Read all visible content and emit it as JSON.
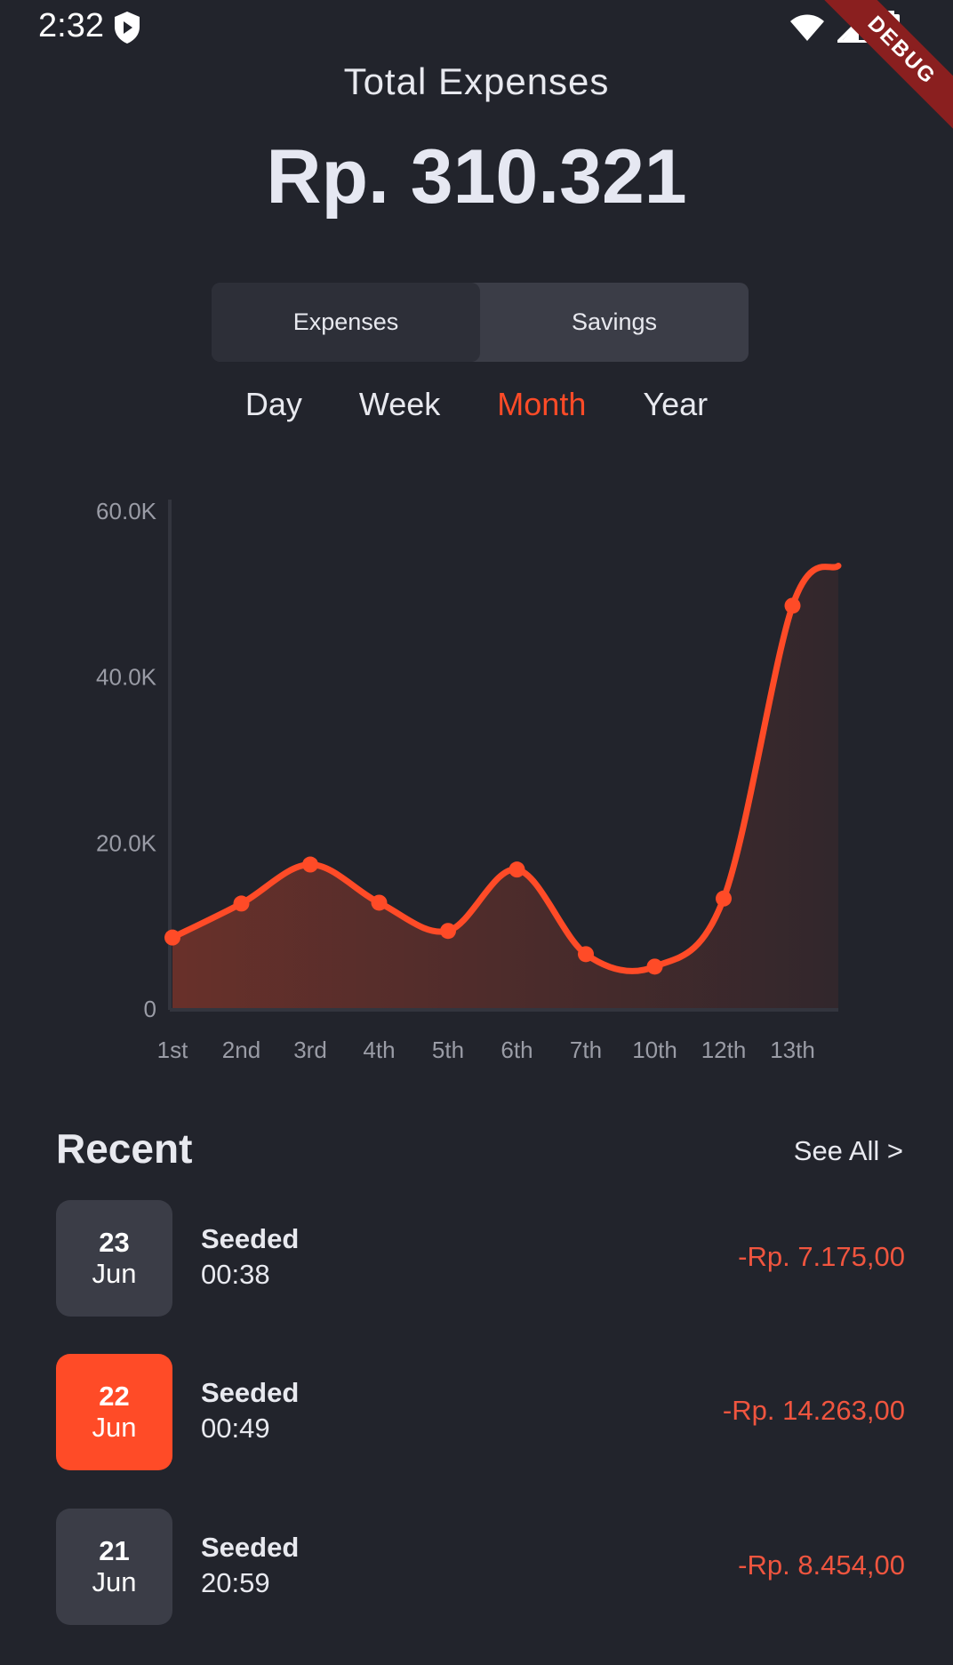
{
  "status_bar": {
    "time": "2:32",
    "debug_label": "DEBUG"
  },
  "header": {
    "title": "Total Expenses",
    "total": "Rp. 310.321"
  },
  "segmented": {
    "options": [
      "Expenses",
      "Savings"
    ],
    "selected": "Expenses"
  },
  "period_tabs": {
    "options": [
      "Day",
      "Week",
      "Month",
      "Year"
    ],
    "selected": "Month"
  },
  "colors": {
    "accent": "#ff4b27",
    "background": "#22242c",
    "card": "#3b3d47",
    "negative_amount": "#f0553f"
  },
  "chart_data": {
    "type": "area",
    "categories": [
      "1st",
      "2nd",
      "3rd",
      "4th",
      "5th",
      "6th",
      "7th",
      "10th",
      "12th",
      "13th"
    ],
    "values": [
      8500,
      12600,
      17300,
      12700,
      9300,
      16700,
      6500,
      5000,
      13200,
      48500
    ],
    "y_ticks": [
      "0",
      "20.0K",
      "40.0K",
      "60.0K"
    ],
    "ylim": [
      0,
      60000
    ],
    "smooth": true,
    "markers": true,
    "grid": false
  },
  "recent": {
    "title": "Recent",
    "see_all": "See All >",
    "items": [
      {
        "day": "23",
        "month": "Jun",
        "name": "Seeded",
        "time": "00:38",
        "amount": "-Rp. 7.175,00",
        "highlight": false
      },
      {
        "day": "22",
        "month": "Jun",
        "name": "Seeded",
        "time": "00:49",
        "amount": "-Rp. 14.263,00",
        "highlight": true
      },
      {
        "day": "21",
        "month": "Jun",
        "name": "Seeded",
        "time": "20:59",
        "amount": "-Rp. 8.454,00",
        "highlight": false
      }
    ]
  }
}
